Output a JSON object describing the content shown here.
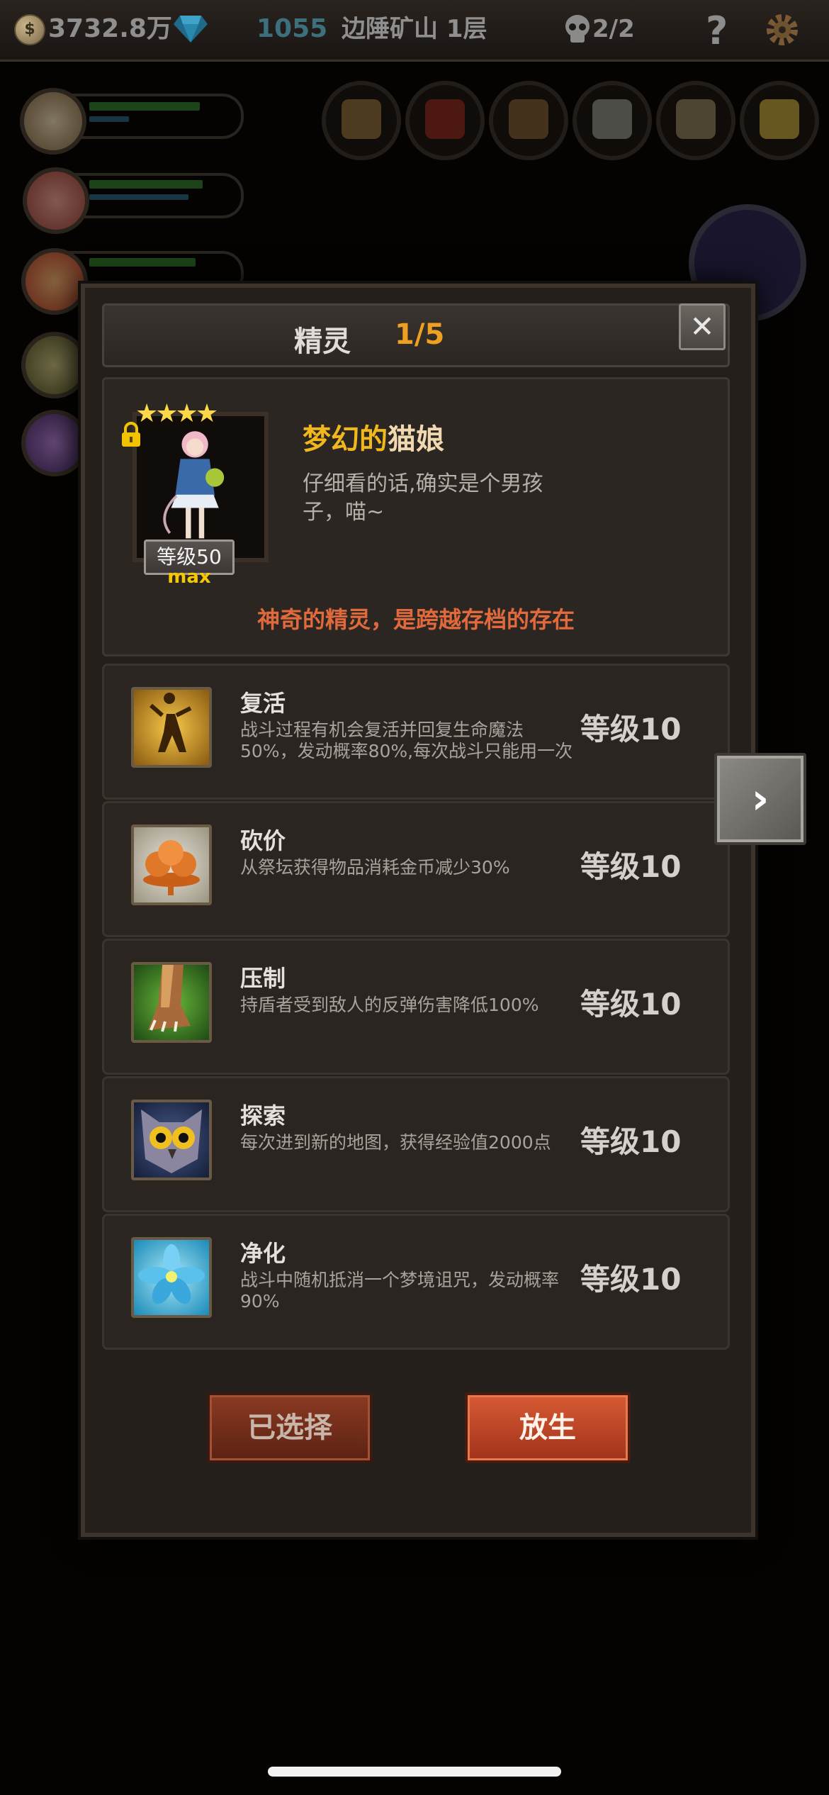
{
  "topbar": {
    "gold": "3732.8万",
    "gems": "1055",
    "location": "边陲矿山 1层",
    "party": "2/2",
    "help": "?"
  },
  "dialog": {
    "title": "精灵",
    "count": "1/5",
    "close": "✕",
    "spirit": {
      "stars": "★★★★",
      "level_badge": "等级50",
      "max": "max",
      "name_part1": "梦幻的",
      "name_part2": "猫娘",
      "description": "仔细看的话,确实是个男孩子，喵~",
      "tagline": "神奇的精灵，是跨越存档的存在"
    },
    "skills": [
      {
        "name": "复活",
        "description": "战斗过程有机会复活并回复生命魔法50%，发动概率80%,每次战斗只能用一次",
        "level": "等级10",
        "icon": "revive-icon"
      },
      {
        "name": "砍价",
        "description": "从祭坛获得物品消耗金币减少30%",
        "level": "等级10",
        "icon": "bargain-icon"
      },
      {
        "name": "压制",
        "description": "持盾者受到敌人的反弹伤害降低100%",
        "level": "等级10",
        "icon": "suppress-icon"
      },
      {
        "name": "探索",
        "description": "每次进到新的地图，获得经验值2000点",
        "level": "等级10",
        "icon": "explore-icon"
      },
      {
        "name": "净化",
        "description": "战斗中随机抵消一个梦境诅咒，发动概率90%",
        "level": "等级10",
        "icon": "purify-icon"
      }
    ],
    "buttons": {
      "selected": "已选择",
      "release": "放生"
    },
    "next": "›"
  },
  "colors": {
    "accent_orange": "#f0a020",
    "tagline_red": "#e06a3c",
    "name_gold": "#f0b81c"
  }
}
